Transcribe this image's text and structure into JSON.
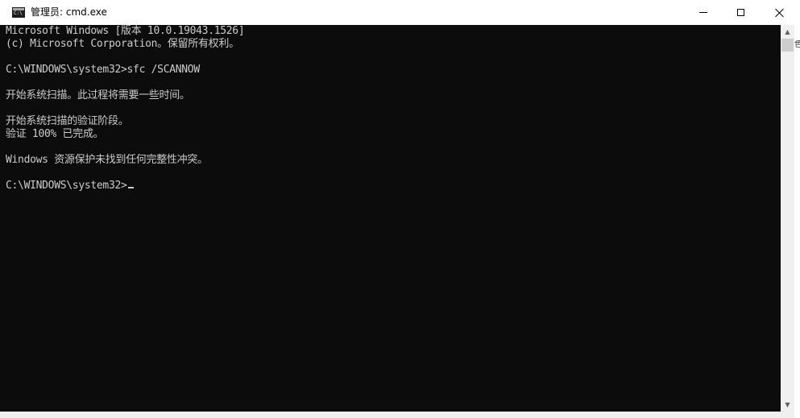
{
  "window": {
    "title": "管理员: cmd.exe",
    "icon": "console-app-icon",
    "icon_label": "C:\\"
  },
  "controls": {
    "minimize_icon": "minimize-icon",
    "maximize_icon": "maximize-icon",
    "close_icon": "close-icon"
  },
  "console": {
    "foreground": "#cccccc",
    "background": "#0c0c0c",
    "lines": [
      "Microsoft Windows [版本 10.0.19043.1526]",
      "(c) Microsoft Corporation。保留所有权利。",
      "",
      "C:\\WINDOWS\\system32>sfc /SCANNOW",
      "",
      "开始系统扫描。此过程将需要一些时间。",
      "",
      "开始系统扫描的验证阶段。",
      "验证 100% 已完成。",
      "",
      "Windows 资源保护未找到任何完整性冲突。",
      "",
      "C:\\WINDOWS\\system32>"
    ]
  },
  "background_window": {
    "partial_text": "色"
  }
}
